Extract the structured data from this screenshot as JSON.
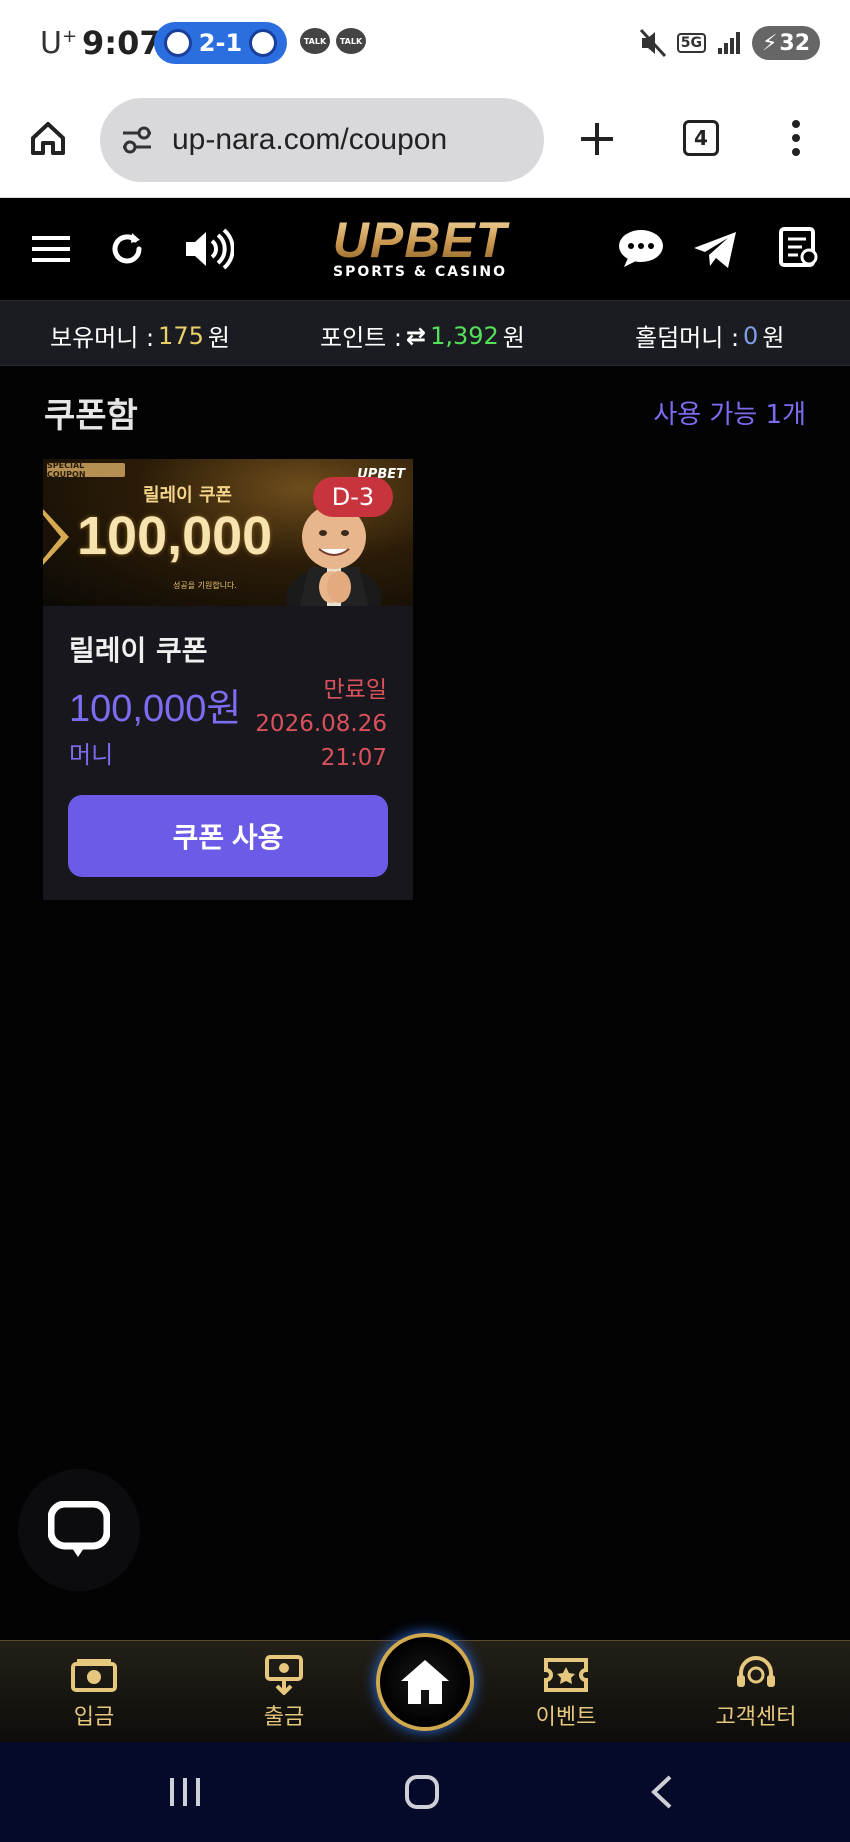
{
  "status_bar": {
    "carrier": "U",
    "carrier_sup": "+",
    "time": "9:07",
    "score": "2-1",
    "talk_badge_1": "TALK",
    "talk_badge_2": "TALK",
    "network": "5G",
    "battery": "32"
  },
  "browser": {
    "url": "up-nara.com/coupon",
    "tab_count": "4"
  },
  "header": {
    "logo_main": "UPBET",
    "logo_sub": "SPORTS & CASINO"
  },
  "balance": {
    "money_label": "보유머니 :",
    "money_value": "175",
    "money_unit": "원",
    "points_label": "포인트 :",
    "points_value": "1,392",
    "points_unit": "원",
    "holdem_label": "홀덤머니 :",
    "holdem_value": "0",
    "holdem_unit": "원"
  },
  "coupon_box": {
    "title": "쿠폰함",
    "available": "사용 가능 1개"
  },
  "coupon": {
    "banner_tag": "SPECIAL COUPON",
    "banner_title": "릴레이 쿠폰",
    "banner_amount": "100,000",
    "banner_caption": "성공을 기원합니다.",
    "banner_logo": "UPBET",
    "d_day": "D-3",
    "name": "릴레이 쿠폰",
    "amount": "100,000원",
    "kind": "머니",
    "expire_label": "만료일",
    "expire_date": "2026.08.26",
    "expire_time": "21:07",
    "use_button": "쿠폰 사용"
  },
  "bottom_nav": {
    "deposit": "입금",
    "withdraw": "출금",
    "event": "이벤트",
    "support": "고객센터"
  },
  "colors": {
    "accent": "#6b5be6",
    "gold": "#e5c87d",
    "danger": "#d9525b"
  }
}
